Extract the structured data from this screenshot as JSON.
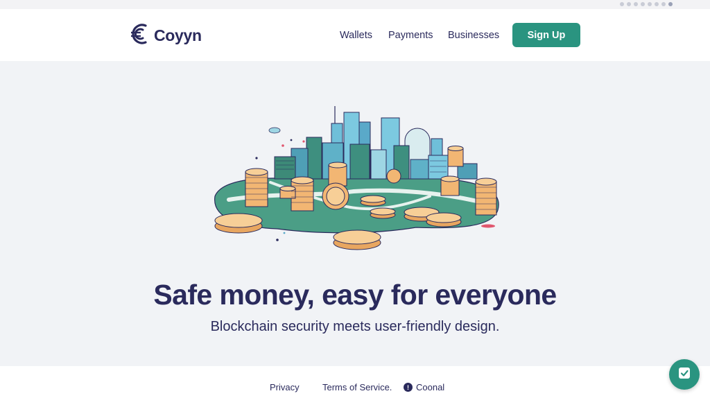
{
  "brand": {
    "name": "Coyyn"
  },
  "nav": {
    "wallets": "Wallets",
    "payments": "Payments",
    "businesses": "Businesses",
    "signup": "Sign Up"
  },
  "hero": {
    "headline": "Safe money, easy for everyone",
    "subheadline": "Blockchain security meets user-friendly design."
  },
  "footer": {
    "privacy": "Privacy",
    "terms": "Terms of Service.",
    "coonal": "Coonal"
  },
  "carousel": {
    "dot_count": 8,
    "active_index": 7
  },
  "colors": {
    "brand_navy": "#2a2a5c",
    "accent_teal": "#2a9480",
    "background": "#f1f3f6"
  },
  "icons": [
    "coyyn-logo-icon",
    "info-icon",
    "chat-check-icon"
  ]
}
